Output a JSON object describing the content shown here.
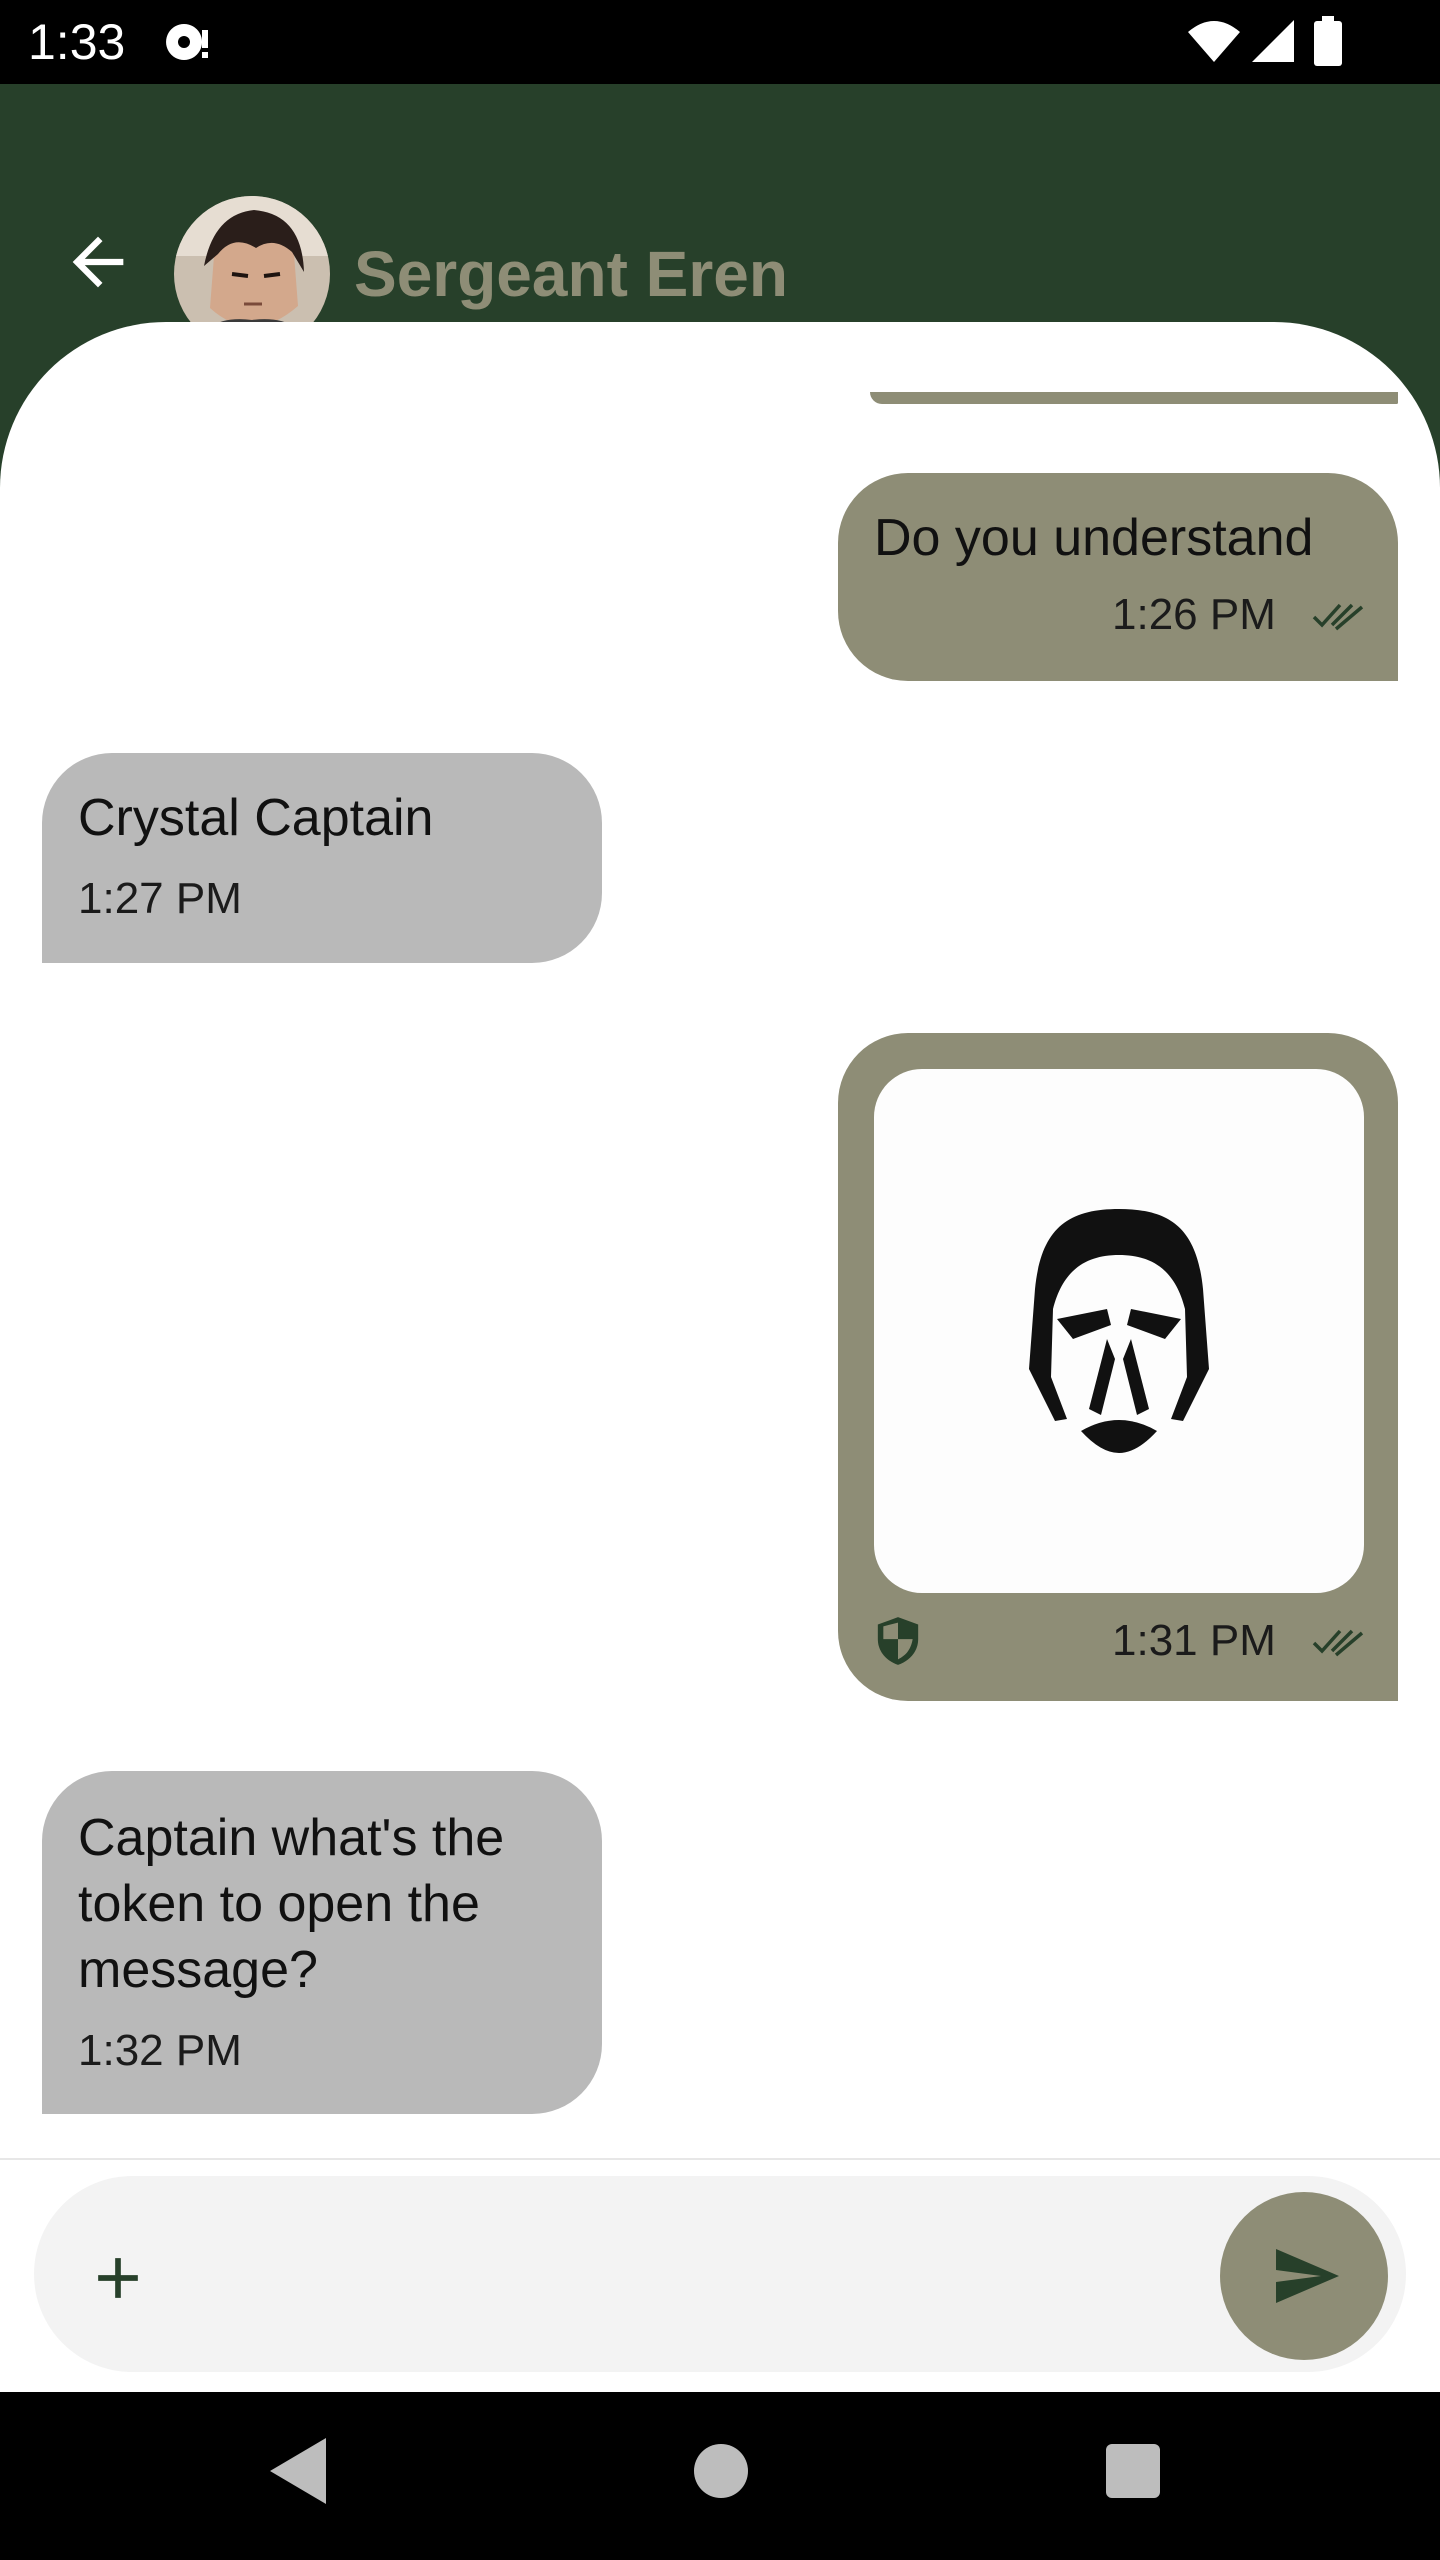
{
  "status_bar": {
    "time": "1:33",
    "icons": [
      "notification-icon",
      "wifi-icon",
      "signal-icon",
      "battery-icon"
    ]
  },
  "header": {
    "contact_name": "Sergeant Eren",
    "back_icon": "arrow-left-icon",
    "avatar": "contact-avatar"
  },
  "messages": [
    {
      "direction": "outgoing",
      "text": "Do you understand",
      "time": "1:26 PM",
      "status_icon": "double-check-icon"
    },
    {
      "direction": "incoming",
      "text": "Crystal Captain",
      "time": "1:27 PM"
    },
    {
      "direction": "outgoing",
      "type": "image",
      "image": "face-logo",
      "badge_icon": "shield-icon",
      "time": "1:31 PM",
      "status_icon": "double-check-icon"
    },
    {
      "direction": "incoming",
      "text": "Captain what's the token to open the message?",
      "time": "1:32 PM"
    }
  ],
  "composer": {
    "placeholder": "",
    "value": "",
    "add_icon": "plus-icon",
    "send_icon": "send-icon"
  },
  "nav_bar": {
    "icons": [
      "nav-back-icon",
      "nav-home-icon",
      "nav-recents-icon"
    ]
  },
  "colors": {
    "app_bar": "#27402a",
    "outgoing_bubble": "#8e8d76",
    "incoming_bubble": "#b9b9b9",
    "contact_name": "#8e8d76",
    "composer_background": "#f3f3f3"
  }
}
